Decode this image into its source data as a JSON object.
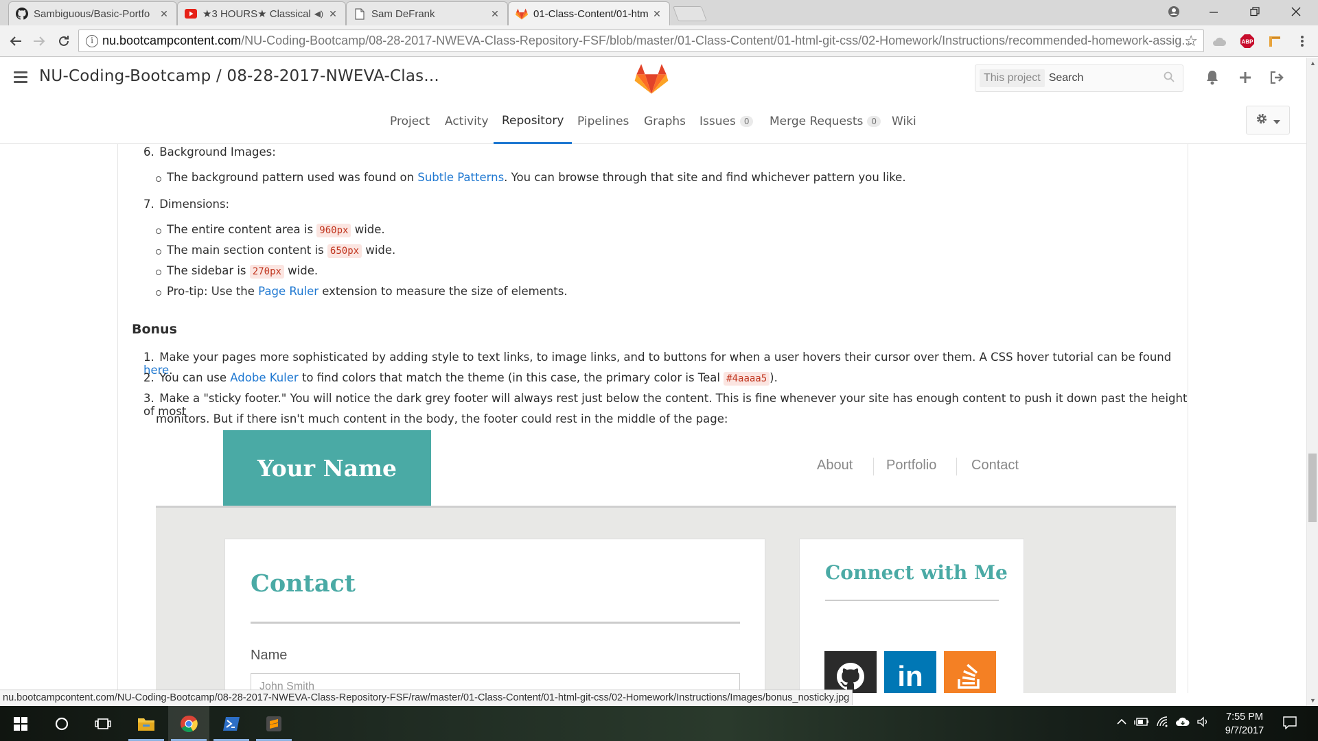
{
  "browser": {
    "tabs": [
      {
        "title": "Sambiguous/Basic-Portfo",
        "icon": "github-icon",
        "muted": false
      },
      {
        "title": "★3 HOURS★ Classical",
        "icon": "youtube-icon",
        "muted": true
      },
      {
        "title": "Sam DeFrank",
        "icon": "document-icon",
        "muted": false
      },
      {
        "title": "01-Class-Content/01-htm",
        "icon": "gitlab-icon",
        "muted": false,
        "active": true
      }
    ],
    "close_glyph": "✕",
    "mute_glyph": "◀)",
    "url_host": "nu.bootcampcontent.com",
    "url_path": "/NU-Coding-Bootcamp/08-28-2017-NWEVA-Class-Repository-FSF/blob/master/01-Class-Content/01-html-git-css/02-Homework/Instructions/recommended-homework-assig...",
    "extension_abp": "ABP",
    "status_url": "nu.bootcampcontent.com/NU-Coding-Bootcamp/08-28-2017-NWEVA-Class-Repository-FSF/raw/master/01-Class-Content/01-html-git-css/02-Homework/Instructions/Images/bonus_nosticky.jpg"
  },
  "gitlab": {
    "project_title": "NU-Coding-Bootcamp / 08-28-2017-NWEVA-Clas...",
    "search_scope": "This project",
    "search_placeholder": "Search",
    "nav": [
      {
        "label": "Project"
      },
      {
        "label": "Activity"
      },
      {
        "label": "Repository",
        "active": true
      },
      {
        "label": "Pipelines"
      },
      {
        "label": "Graphs"
      },
      {
        "label": "Issues",
        "count": "0"
      },
      {
        "label": "Merge Requests",
        "count": "0"
      },
      {
        "label": "Wiki"
      }
    ],
    "brand_colors": {
      "gitlab_orange": "#e24329",
      "gitlab_light": "#fca326",
      "link": "#1f78d1"
    }
  },
  "doc": {
    "item6": {
      "num": "6.",
      "title": "Background Images:",
      "bullet_pre": "The background pattern used was found on ",
      "bullet_link": "Subtle Patterns",
      "bullet_post": ". You can browse through that site and find whichever pattern you like."
    },
    "item7": {
      "num": "7.",
      "title": "Dimensions:",
      "b1_pre": "The entire content area is ",
      "b1_code": "960px",
      "b1_post": " wide.",
      "b2_pre": "The main section content is ",
      "b2_code": "650px",
      "b2_post": " wide.",
      "b3_pre": "The sidebar is ",
      "b3_code": "270px",
      "b3_post": " wide.",
      "b4_pre": "Pro-tip: Use the ",
      "b4_link": "Page Ruler",
      "b4_post": " extension to measure the size of elements."
    },
    "bonus_heading": "Bonus",
    "bonus": [
      {
        "num": "1.",
        "pre": "Make your pages more sophisticated by adding style to text links, to image links, and to buttons for when a user hovers their cursor over them. A CSS hover tutorial can be found ",
        "link": "here",
        "post": "."
      },
      {
        "num": "2.",
        "pre": "You can use ",
        "link": "Adobe Kuler",
        "mid": " to find colors that match the theme (in this case, the primary color is Teal ",
        "code": "#4aaaa5",
        "post": ")."
      },
      {
        "num": "3.",
        "line1": "Make a \"sticky footer.\" You will notice the dark grey footer will always rest just below the content. This is fine whenever your site has enough content to push it down past the height of most",
        "line2": "monitors. But if there isn't much content in the body, the footer could rest in the middle of the page:"
      }
    ]
  },
  "embedded_image": {
    "brand": "Your Name",
    "nav": [
      "About",
      "Portfolio",
      "Contact"
    ],
    "contact_heading": "Contact",
    "name_label": "Name",
    "name_placeholder": "John Smith",
    "connect_heading": "Connect with Me",
    "social_icons": [
      "github-icon",
      "linkedin-icon",
      "stackoverflow-icon"
    ],
    "linkedin_text": "in",
    "teal": "#4aaaa5"
  },
  "taskbar": {
    "time": "7:55 PM",
    "date": "9/7/2017",
    "apps": [
      "start-icon",
      "cortana-icon",
      "task-view-icon",
      "file-explorer-icon",
      "chrome-icon",
      "powershell-icon",
      "sublime-text-icon"
    ]
  }
}
